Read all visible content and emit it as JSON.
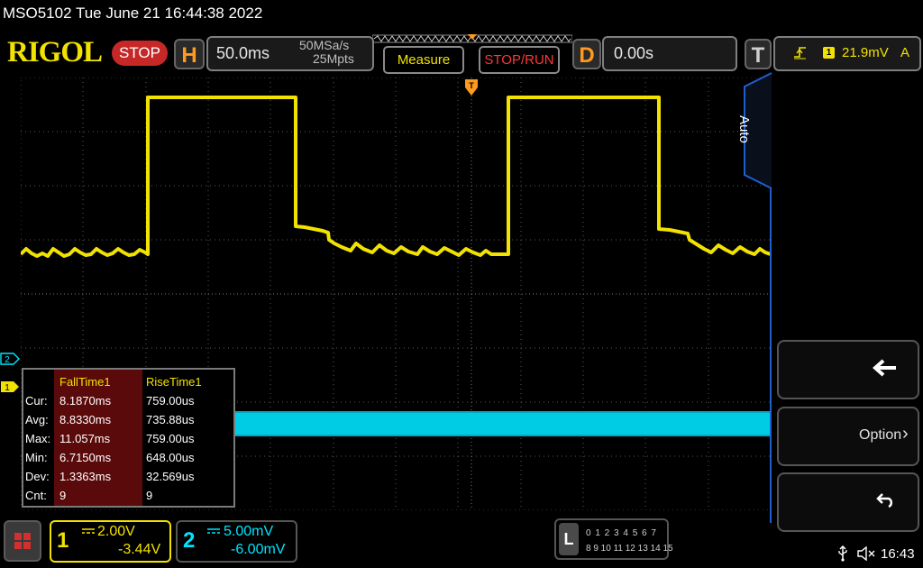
{
  "header": {
    "title": "MSO5102  Tue June 21 16:44:38 2022",
    "logo": "RIGOL",
    "run_state": "STOP",
    "horizontal": {
      "letter": "H",
      "scale": "50.0ms",
      "sample_rate": "50MSa/s",
      "memory_depth": "25Mpts"
    },
    "measure_label": "Measure",
    "stop_run_label": "STOP/RUN",
    "delay": {
      "letter": "D",
      "value": "0.00s"
    },
    "trigger": {
      "letter": "T",
      "edge_icon": "rising-edge-icon",
      "source": "1",
      "level": "21.9mV",
      "mode": "A"
    }
  },
  "colors": {
    "ch1": "#f2e200",
    "ch2": "#00e5ff",
    "accent": "#ff9a1e",
    "stop": "#c62828"
  },
  "markers": {
    "ch1": "1",
    "ch2": "2"
  },
  "measurements": {
    "headers": [
      "FallTime1",
      "RiseTime1"
    ],
    "rows": [
      {
        "label": "Cur:",
        "fall": "8.1870ms",
        "rise": "759.00us"
      },
      {
        "label": "Avg:",
        "fall": "8.8330ms",
        "rise": "735.88us"
      },
      {
        "label": "Max:",
        "fall": "11.057ms",
        "rise": "759.00us"
      },
      {
        "label": "Min:",
        "fall": "6.7150ms",
        "rise": "648.00us"
      },
      {
        "label": "Dev:",
        "fall": "1.3363ms",
        "rise": "32.569us"
      },
      {
        "label": "Cnt:",
        "fall": "9",
        "rise": "9"
      }
    ]
  },
  "side_menu": {
    "auto_label": "Auto",
    "back_icon": "back-arrow-icon",
    "option_label": "Option",
    "return_icon": "return-icon"
  },
  "channels": {
    "ch1": {
      "number": "1",
      "coupling_icon": "dc-coupling-icon",
      "scale": "2.00V",
      "offset": "-3.44V"
    },
    "ch2": {
      "number": "2",
      "coupling_icon": "dc-coupling-icon",
      "scale": "5.00mV",
      "offset": "-6.00mV"
    }
  },
  "logic_analyzer": {
    "letter": "L",
    "row1": "0 1 2 3   4 5 6 7",
    "row2": "8 9 10 11 12 13 14 15"
  },
  "status": {
    "clock": "16:43"
  }
}
